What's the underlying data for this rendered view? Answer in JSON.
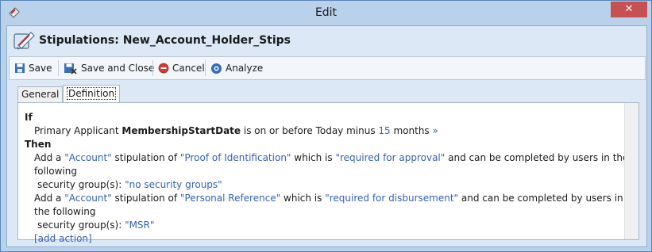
{
  "window": {
    "title": "Edit",
    "close_glyph": "✕"
  },
  "header": {
    "title": "Stipulations: New_Account_Holder_Stips"
  },
  "toolbar": {
    "save": "Save",
    "save_close": "Save and Close",
    "cancel": "Cancel",
    "analyze": "Analyze"
  },
  "tabs": {
    "general": "General",
    "definition": "Definition"
  },
  "rule": {
    "if_kw": "If",
    "condition": {
      "prefix": "Primary Applicant ",
      "field": "MembershipStartDate",
      "operator": " is on or before Today minus ",
      "value": "15",
      "unit": " months",
      "more": " »"
    },
    "then_kw": "Then",
    "actions": [
      {
        "add": "Add a ",
        "entity": "\"Account\"",
        "mid1": " stipulation of ",
        "stip": "\"Proof of Identification\"",
        "mid2": " which is ",
        "req": "\"required for approval\"",
        "tail": " and can be completed by users in the following",
        "line2": "security group(s): ",
        "group": "\"no security groups\""
      },
      {
        "add": "Add a ",
        "entity": "\"Account\"",
        "mid1": " stipulation of ",
        "stip": "\"Personal Reference\"",
        "mid2": " which is ",
        "req": "\"required for disbursement\"",
        "tail": " and can be completed by users in the following",
        "line2": "security group(s): ",
        "group": "\"MSR\""
      }
    ],
    "add_action": "[add action]"
  },
  "colors": {
    "link": "#3462b4",
    "titlebar": "#b9d1ea",
    "close": "#c75050"
  }
}
